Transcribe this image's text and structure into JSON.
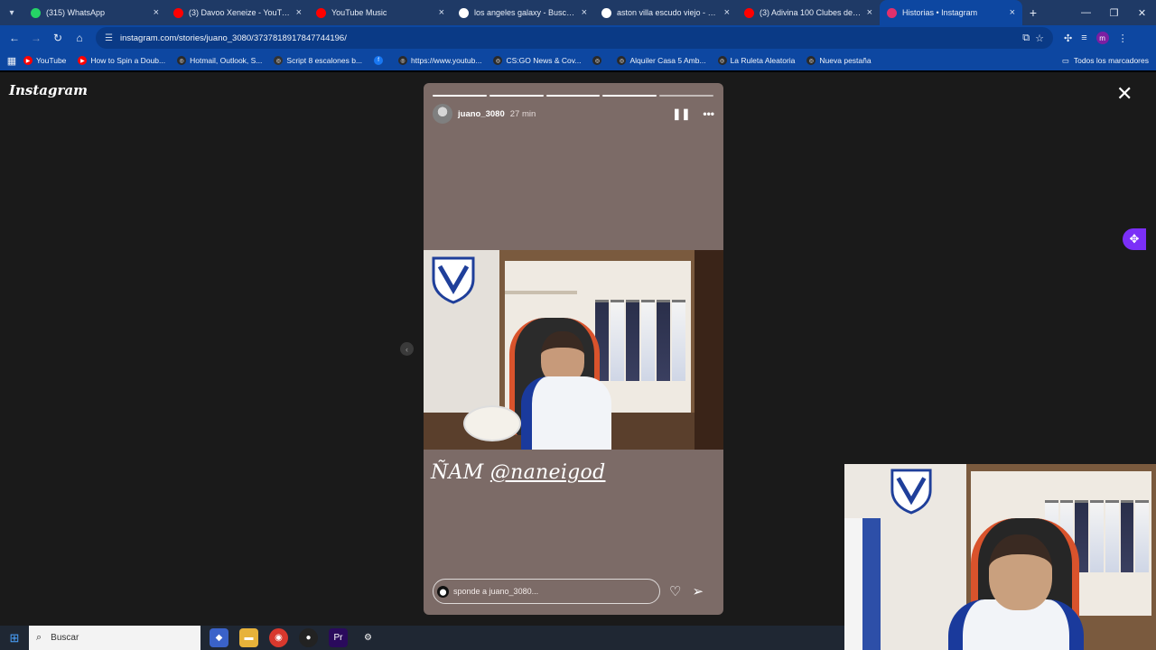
{
  "browser": {
    "tabs": [
      {
        "label": "(315) WhatsApp",
        "icon": "whatsapp-icon",
        "color": "#25d366",
        "active": false
      },
      {
        "label": "(3) Davoo Xeneize - YouTube",
        "icon": "youtube-icon",
        "color": "#ff0000",
        "active": false
      },
      {
        "label": "YouTube Music",
        "icon": "youtube-music-icon",
        "color": "#ff0000",
        "active": false
      },
      {
        "label": "los angeles galaxy - Buscar con",
        "icon": "google-icon",
        "color": "#ffffff",
        "active": false
      },
      {
        "label": "aston villa escudo viejo - Busca",
        "icon": "google-icon",
        "color": "#ffffff",
        "active": false
      },
      {
        "label": "(3) Adivina 100 Clubes de Fútb",
        "icon": "youtube-icon",
        "color": "#ff0000",
        "active": false
      },
      {
        "label": "Historias • Instagram",
        "icon": "instagram-icon",
        "color": "#e1306c",
        "active": true
      }
    ],
    "url": "instagram.com/stories/juano_3080/3737818917847744196/",
    "bookmarks": [
      {
        "label": "YouTube",
        "icon": "youtube-icon",
        "color": "#ff0000"
      },
      {
        "label": "How to Spin a Doub...",
        "icon": "youtube-icon",
        "color": "#ff0000"
      },
      {
        "label": "Hotmail, Outlook, S...",
        "icon": "globe-icon",
        "color": "#2a2a2a"
      },
      {
        "label": "Script 8 escalones b...",
        "icon": "site-icon",
        "color": "#333333"
      },
      {
        "label": "",
        "icon": "facebook-icon",
        "color": "#1877f2"
      },
      {
        "label": "https://www.youtub...",
        "icon": "globe-icon",
        "color": "#2a2a2a"
      },
      {
        "label": "CS:GO News & Cov...",
        "icon": "globe-icon",
        "color": "#2a2a2a"
      },
      {
        "label": "",
        "icon": "globe-icon",
        "color": "#2a2a2a"
      },
      {
        "label": "Alquiler Casa 5 Amb...",
        "icon": "globe-icon",
        "color": "#2a2a2a"
      },
      {
        "label": "La Ruleta Aleatoria",
        "icon": "globe-icon",
        "color": "#2a2a2a"
      },
      {
        "label": "Nueva pestaña",
        "icon": "globe-icon",
        "color": "#2a2a2a"
      }
    ],
    "all_bookmarks": "Todos los marcadores"
  },
  "instagram": {
    "logo": "Instagram",
    "story": {
      "username": "juano_3080",
      "time": "27 min",
      "segments_total": 5,
      "segments_done": 4,
      "text_plain": "ÑAM ",
      "text_mention": "@naneigod",
      "reply_placeholder": "Responde a juano_3080...",
      "reply_visible": "sponde a juano_3080..."
    }
  },
  "taskbar": {
    "search_placeholder": "Buscar"
  },
  "colors": {
    "tab_bar": "#1f3a66",
    "chrome_blue": "#0d47a1",
    "story_bg": "#7c6b67",
    "page_bg": "#1a1a1a"
  }
}
